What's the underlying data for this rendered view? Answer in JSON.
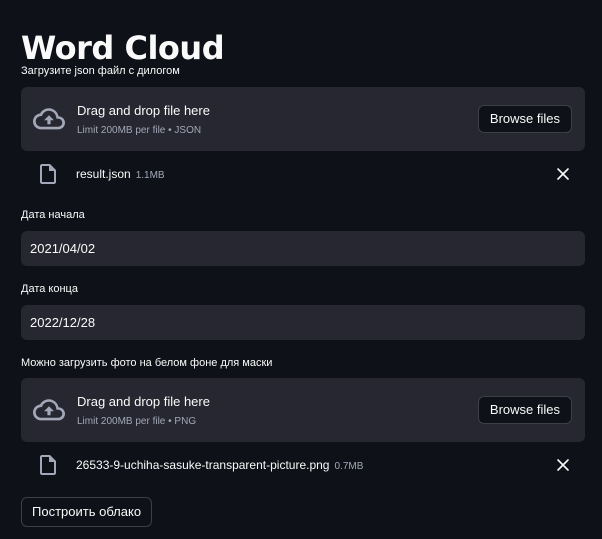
{
  "page": {
    "title": "Word Cloud"
  },
  "json_uploader": {
    "label": "Загрузите json файл с дилогом",
    "drop_text": "Drag and drop file here",
    "limit_text": "Limit 200MB per file • JSON",
    "browse_label": "Browse files",
    "file": {
      "name": "result.json",
      "size": "1.1MB"
    }
  },
  "start_date": {
    "label": "Дата начала",
    "value": "2021/04/02"
  },
  "end_date": {
    "label": "Дата конца",
    "value": "2022/12/28"
  },
  "mask_uploader": {
    "label": "Можно загрузить фото на белом фоне для маски",
    "drop_text": "Drag and drop file here",
    "limit_text": "Limit 200MB per file • PNG",
    "browse_label": "Browse files",
    "file": {
      "name": "26533-9-uchiha-sasuke-transparent-picture.png",
      "size": "0.7MB"
    }
  },
  "submit": {
    "label": "Построить облако"
  },
  "icons": {
    "upload": "cloud-upload-icon",
    "file": "file-icon",
    "remove": "close-icon"
  },
  "colors": {
    "background": "#0e1117",
    "surface": "#262730",
    "text": "#fafafa",
    "muted": "#a3a8b8",
    "border": "#3c3f4a"
  }
}
